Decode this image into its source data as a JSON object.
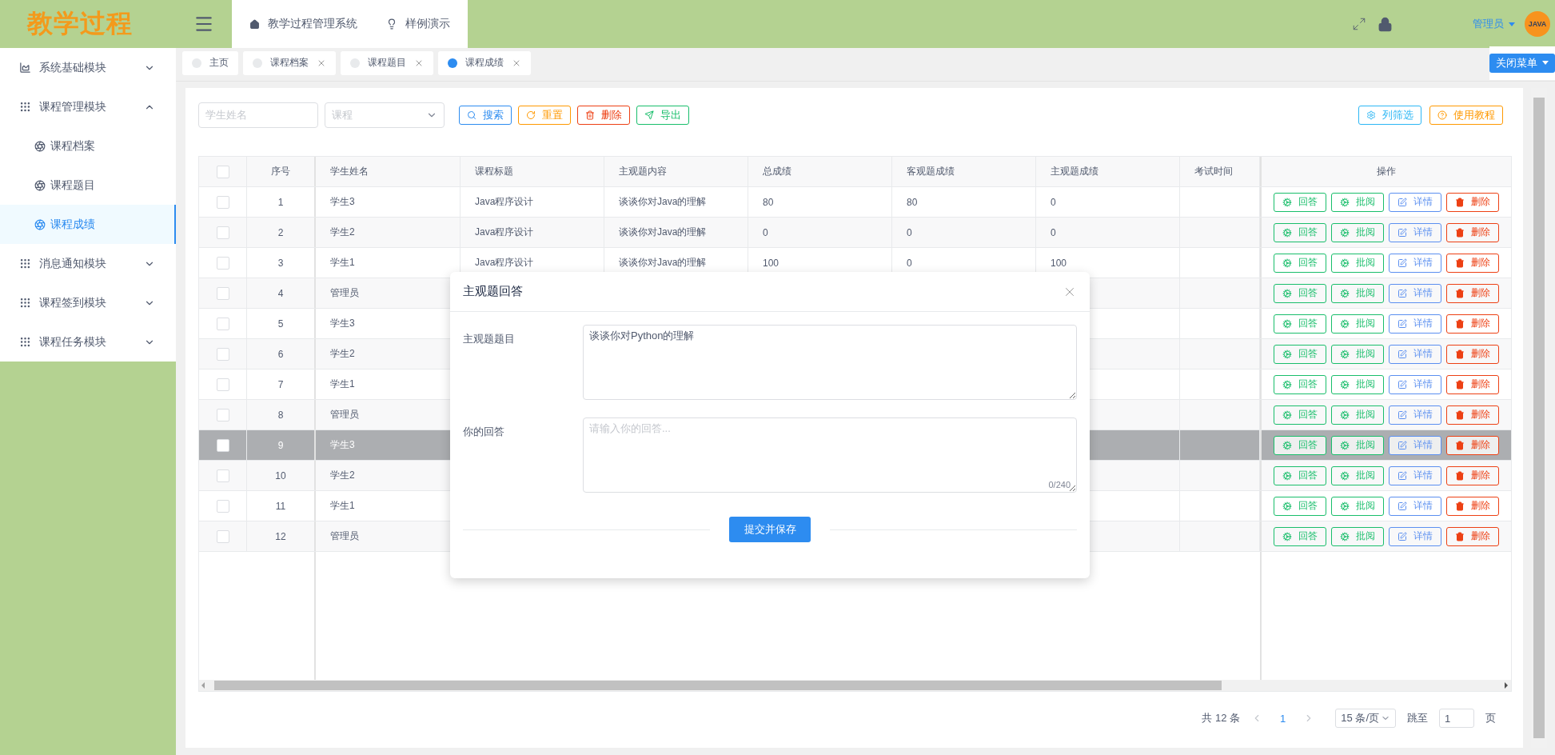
{
  "app": {
    "logo": "教学过程",
    "breadcrumbs": [
      {
        "label": "教学过程管理系统",
        "kind": "home"
      },
      {
        "label": "样例演示",
        "kind": "bulb"
      }
    ],
    "user": "管理员",
    "avatar_text": "JAVA"
  },
  "sidebar": {
    "items": [
      {
        "label": "系统基础模块",
        "kind": "chart",
        "expanded": false
      },
      {
        "label": "课程管理模块",
        "kind": "grid",
        "expanded": true,
        "children": [
          {
            "label": "课程档案",
            "selected": false
          },
          {
            "label": "课程题目",
            "selected": false
          },
          {
            "label": "课程成绩",
            "selected": true
          }
        ]
      },
      {
        "label": "消息通知模块",
        "kind": "grid",
        "expanded": false
      },
      {
        "label": "课程签到模块",
        "kind": "grid",
        "expanded": false
      },
      {
        "label": "课程任务模块",
        "kind": "grid",
        "expanded": false
      }
    ]
  },
  "tabs": [
    {
      "label": "主页",
      "selected": false,
      "closable": false
    },
    {
      "label": "课程档案",
      "selected": false,
      "closable": true
    },
    {
      "label": "课程题目",
      "selected": false,
      "closable": true
    },
    {
      "label": "课程成绩",
      "selected": true,
      "closable": true
    }
  ],
  "close_menu": "关闭菜单",
  "filters": {
    "name_placeholder": "学生姓名",
    "course_placeholder": "课程",
    "buttons": [
      {
        "label": "搜索",
        "kind": "search"
      },
      {
        "label": "重置",
        "kind": "reset"
      },
      {
        "label": "删除",
        "kind": "delete"
      },
      {
        "label": "导出",
        "kind": "export"
      }
    ],
    "tools": [
      {
        "label": "列筛选",
        "kind": "columns"
      },
      {
        "label": "使用教程",
        "kind": "help"
      }
    ]
  },
  "table": {
    "all_checked": false,
    "columns": [
      "序号",
      "学生姓名",
      "课程标题",
      "主观题内容",
      "总成绩",
      "客观题成绩",
      "主观题成绩",
      "考试时间",
      "操作"
    ],
    "rows": [
      {
        "checked": false,
        "highlighted": false,
        "cells": [
          "1",
          "学生3",
          "Java程序设计",
          "谈谈你对Java的理解",
          "80",
          "80",
          "0"
        ],
        "actions": [
          {
            "label": "回答",
            "kind": "answer"
          },
          {
            "label": "批阅",
            "kind": "review"
          },
          {
            "label": "详情",
            "kind": "detail"
          },
          {
            "label": "删除",
            "kind": "delete"
          }
        ]
      },
      {
        "checked": false,
        "highlighted": false,
        "cells": [
          "2",
          "学生2",
          "Java程序设计",
          "谈谈你对Java的理解",
          "0",
          "0",
          "0"
        ],
        "actions": [
          {
            "label": "回答",
            "kind": "answer"
          },
          {
            "label": "批阅",
            "kind": "review"
          },
          {
            "label": "详情",
            "kind": "detail"
          },
          {
            "label": "删除",
            "kind": "delete"
          }
        ]
      },
      {
        "checked": false,
        "highlighted": false,
        "cells": [
          "3",
          "学生1",
          "Java程序设计",
          "谈谈你对Java的理解",
          "100",
          "0",
          "100"
        ],
        "actions": [
          {
            "label": "回答",
            "kind": "answer"
          },
          {
            "label": "批阅",
            "kind": "review"
          },
          {
            "label": "详情",
            "kind": "detail"
          },
          {
            "label": "删除",
            "kind": "delete"
          }
        ]
      },
      {
        "checked": false,
        "highlighted": false,
        "cells": [
          "4",
          "管理员"
        ],
        "actions": [
          {
            "label": "回答",
            "kind": "answer"
          },
          {
            "label": "批阅",
            "kind": "review"
          },
          {
            "label": "详情",
            "kind": "detail"
          },
          {
            "label": "删除",
            "kind": "delete"
          }
        ]
      },
      {
        "checked": false,
        "highlighted": false,
        "cells": [
          "5",
          "学生3"
        ],
        "actions": [
          {
            "label": "回答",
            "kind": "answer"
          },
          {
            "label": "批阅",
            "kind": "review"
          },
          {
            "label": "详情",
            "kind": "detail"
          },
          {
            "label": "删除",
            "kind": "delete"
          }
        ]
      },
      {
        "checked": false,
        "highlighted": false,
        "cells": [
          "6",
          "学生2"
        ],
        "actions": [
          {
            "label": "回答",
            "kind": "answer"
          },
          {
            "label": "批阅",
            "kind": "review"
          },
          {
            "label": "详情",
            "kind": "detail"
          },
          {
            "label": "删除",
            "kind": "delete"
          }
        ]
      },
      {
        "checked": false,
        "highlighted": false,
        "cells": [
          "7",
          "学生1"
        ],
        "actions": [
          {
            "label": "回答",
            "kind": "answer"
          },
          {
            "label": "批阅",
            "kind": "review"
          },
          {
            "label": "详情",
            "kind": "detail"
          },
          {
            "label": "删除",
            "kind": "delete"
          }
        ]
      },
      {
        "checked": false,
        "highlighted": false,
        "cells": [
          "8",
          "管理员"
        ],
        "actions": [
          {
            "label": "回答",
            "kind": "answer"
          },
          {
            "label": "批阅",
            "kind": "review"
          },
          {
            "label": "详情",
            "kind": "detail"
          },
          {
            "label": "删除",
            "kind": "delete"
          }
        ]
      },
      {
        "checked": false,
        "highlighted": true,
        "cells": [
          "9",
          "学生3"
        ],
        "actions": [
          {
            "label": "回答",
            "kind": "answer"
          },
          {
            "label": "批阅",
            "kind": "review"
          },
          {
            "label": "详情",
            "kind": "detail"
          },
          {
            "label": "删除",
            "kind": "delete"
          }
        ]
      },
      {
        "checked": false,
        "highlighted": false,
        "cells": [
          "10",
          "学生2"
        ],
        "actions": [
          {
            "label": "回答",
            "kind": "answer"
          },
          {
            "label": "批阅",
            "kind": "review"
          },
          {
            "label": "详情",
            "kind": "detail"
          },
          {
            "label": "删除",
            "kind": "delete"
          }
        ]
      },
      {
        "checked": false,
        "highlighted": false,
        "cells": [
          "11",
          "学生1"
        ],
        "actions": [
          {
            "label": "回答",
            "kind": "answer"
          },
          {
            "label": "批阅",
            "kind": "review"
          },
          {
            "label": "详情",
            "kind": "detail"
          },
          {
            "label": "删除",
            "kind": "delete"
          }
        ]
      },
      {
        "checked": false,
        "highlighted": false,
        "cells": [
          "12",
          "管理员"
        ],
        "actions": [
          {
            "label": "回答",
            "kind": "answer"
          },
          {
            "label": "批阅",
            "kind": "review"
          },
          {
            "label": "详情",
            "kind": "detail"
          },
          {
            "label": "删除",
            "kind": "delete"
          }
        ]
      }
    ]
  },
  "pagination": {
    "total": "共 12 条",
    "pages": [
      {
        "label": "1",
        "selected": true
      }
    ],
    "page_size": "15 条/页",
    "jump_label": "跳至",
    "jump_value": "1",
    "jump_suffix": "页"
  },
  "dialog": {
    "title": "主观题回答",
    "fields": [
      {
        "label": "主观题题目",
        "value": "谈谈你对Python的理解"
      },
      {
        "label": "你的回答",
        "placeholder": "请输入你的回答...",
        "counter": "0/240"
      }
    ],
    "submit": "提交并保存"
  }
}
